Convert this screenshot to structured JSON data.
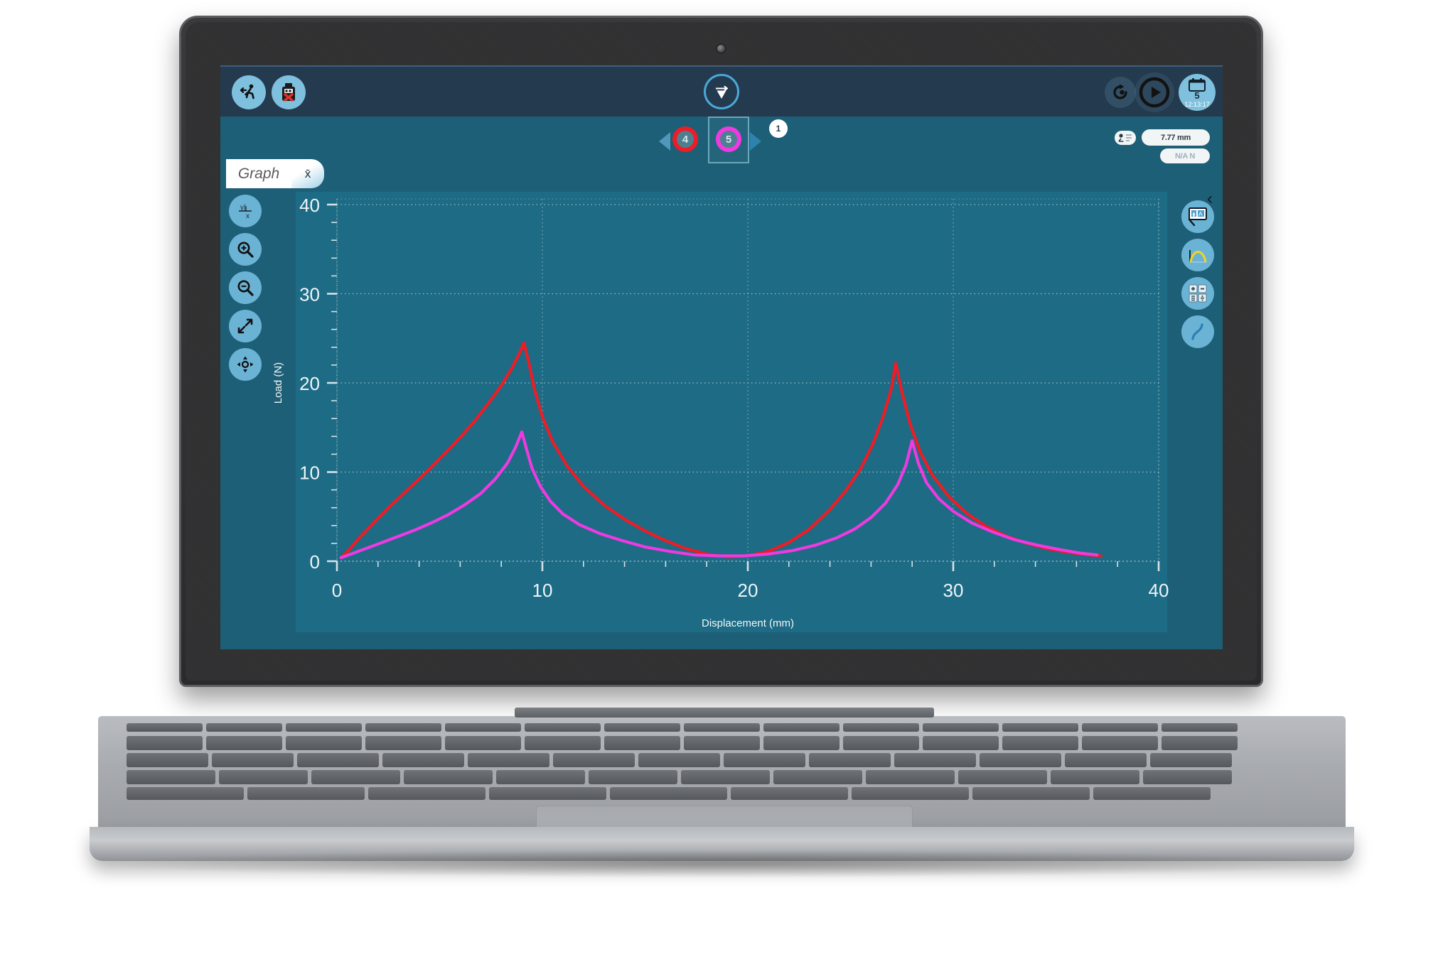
{
  "app": {
    "logo_label": "v",
    "toolbar_left": [
      {
        "name": "exit-activity-icon",
        "label": "Exit"
      },
      {
        "name": "usb-eject-icon",
        "label": "Disconnect USB"
      }
    ],
    "toolbar_right": [
      {
        "name": "replay-icon",
        "label": "Replay"
      },
      {
        "name": "play-icon",
        "label": "Collect"
      }
    ],
    "calendar_button": {
      "day": "5",
      "time": "12:13:17"
    }
  },
  "dataset_selector": {
    "prev_label": "◀",
    "next_label": "▶",
    "datasets": [
      {
        "label": "4",
        "color": "#ee1c25",
        "selected": false
      },
      {
        "label": "5",
        "color": "#ee3ae0",
        "selected": true
      }
    ],
    "badge": "1"
  },
  "readouts": {
    "cursor_icon": "➤",
    "value_x": "7.77 mm",
    "value_y": "N/A N"
  },
  "tabs": [
    {
      "label": "Graph",
      "name": "tab-graph",
      "active": true
    },
    {
      "label": "x̄",
      "name": "tab-statistics",
      "active": false
    }
  ],
  "left_tools": [
    {
      "name": "axes-options-icon",
      "label": "y|x"
    },
    {
      "name": "zoom-in-icon",
      "label": "Zoom In"
    },
    {
      "name": "zoom-out-icon",
      "label": "Zoom Out"
    },
    {
      "name": "autoscale-icon",
      "label": "Autoscale"
    },
    {
      "name": "pan-icon",
      "label": "Pan"
    }
  ],
  "right_tools": [
    {
      "name": "annotation-icon",
      "label": "Add Annotation"
    },
    {
      "name": "curve-fit-icon",
      "label": "Curve Fit"
    },
    {
      "name": "calculator-icon",
      "label": "Calculations"
    },
    {
      "name": "smooth-curve-icon",
      "label": "Model"
    }
  ],
  "collapse_label": "‹",
  "chart_data": {
    "type": "line",
    "title": "",
    "xlabel": "Displacement (mm)",
    "ylabel": "Load (N)",
    "xlim": [
      0,
      40
    ],
    "ylim": [
      0,
      40
    ],
    "xticks": [
      0,
      10,
      20,
      30,
      40
    ],
    "yticks": [
      0,
      10,
      20,
      30,
      40
    ],
    "x_minor_step": 2,
    "y_minor_step": 2,
    "grid": true,
    "legend": "none",
    "background": "#1d6b85",
    "series": [
      {
        "name": "Run 4",
        "color": "#ee1c25",
        "points": [
          [
            0.2,
            0.4
          ],
          [
            0.6,
            1.3
          ],
          [
            1.0,
            2.4
          ],
          [
            1.5,
            3.6
          ],
          [
            2.0,
            4.8
          ],
          [
            2.6,
            6.2
          ],
          [
            3.2,
            7.5
          ],
          [
            3.8,
            8.8
          ],
          [
            4.4,
            10.1
          ],
          [
            5.0,
            11.5
          ],
          [
            5.6,
            12.9
          ],
          [
            6.2,
            14.4
          ],
          [
            6.8,
            16.0
          ],
          [
            7.4,
            17.8
          ],
          [
            8.0,
            19.7
          ],
          [
            8.5,
            21.6
          ],
          [
            8.9,
            23.4
          ],
          [
            9.1,
            24.5
          ],
          [
            9.35,
            22.2
          ],
          [
            9.6,
            19.4
          ],
          [
            10.0,
            16.2
          ],
          [
            10.5,
            13.4
          ],
          [
            11.2,
            10.7
          ],
          [
            12.0,
            8.4
          ],
          [
            13.0,
            6.3
          ],
          [
            14.0,
            4.7
          ],
          [
            15.0,
            3.4
          ],
          [
            16.0,
            2.3
          ],
          [
            17.0,
            1.4
          ],
          [
            18.0,
            0.8
          ],
          [
            19.0,
            0.5
          ],
          [
            20.0,
            0.6
          ],
          [
            21.0,
            1.1
          ],
          [
            22.0,
            2.1
          ],
          [
            23.0,
            3.6
          ],
          [
            24.0,
            5.8
          ],
          [
            24.8,
            8.0
          ],
          [
            25.5,
            10.4
          ],
          [
            26.1,
            13.2
          ],
          [
            26.6,
            16.3
          ],
          [
            27.0,
            19.5
          ],
          [
            27.2,
            22.2
          ],
          [
            27.5,
            19.0
          ],
          [
            27.9,
            15.4
          ],
          [
            28.4,
            12.2
          ],
          [
            29.0,
            9.6
          ],
          [
            29.8,
            7.2
          ],
          [
            30.7,
            5.3
          ],
          [
            31.6,
            3.9
          ],
          [
            32.6,
            2.8
          ],
          [
            33.6,
            2.0
          ],
          [
            34.6,
            1.4
          ],
          [
            35.6,
            1.0
          ],
          [
            36.6,
            0.7
          ],
          [
            37.2,
            0.6
          ]
        ]
      },
      {
        "name": "Run 5",
        "color": "#ee3ae0",
        "points": [
          [
            0.2,
            0.4
          ],
          [
            0.8,
            0.9
          ],
          [
            1.5,
            1.5
          ],
          [
            2.2,
            2.1
          ],
          [
            3.0,
            2.8
          ],
          [
            3.8,
            3.5
          ],
          [
            4.6,
            4.3
          ],
          [
            5.4,
            5.2
          ],
          [
            6.2,
            6.3
          ],
          [
            7.0,
            7.6
          ],
          [
            7.7,
            9.2
          ],
          [
            8.3,
            11.0
          ],
          [
            8.7,
            12.8
          ],
          [
            9.0,
            14.5
          ],
          [
            9.25,
            12.4
          ],
          [
            9.5,
            10.4
          ],
          [
            9.9,
            8.4
          ],
          [
            10.4,
            6.7
          ],
          [
            11.0,
            5.3
          ],
          [
            11.8,
            4.1
          ],
          [
            12.8,
            3.1
          ],
          [
            13.9,
            2.3
          ],
          [
            15.0,
            1.6
          ],
          [
            16.2,
            1.1
          ],
          [
            17.4,
            0.7
          ],
          [
            18.6,
            0.6
          ],
          [
            19.8,
            0.6
          ],
          [
            21.0,
            0.8
          ],
          [
            22.2,
            1.2
          ],
          [
            23.3,
            1.8
          ],
          [
            24.3,
            2.6
          ],
          [
            25.2,
            3.6
          ],
          [
            26.0,
            4.9
          ],
          [
            26.7,
            6.5
          ],
          [
            27.3,
            8.6
          ],
          [
            27.7,
            10.8
          ],
          [
            28.0,
            13.5
          ],
          [
            28.3,
            11.0
          ],
          [
            28.7,
            8.8
          ],
          [
            29.3,
            7.0
          ],
          [
            30.0,
            5.6
          ],
          [
            30.9,
            4.3
          ],
          [
            31.9,
            3.3
          ],
          [
            33.0,
            2.4
          ],
          [
            34.1,
            1.8
          ],
          [
            35.2,
            1.3
          ],
          [
            36.2,
            0.9
          ],
          [
            37.0,
            0.7
          ]
        ]
      }
    ]
  }
}
